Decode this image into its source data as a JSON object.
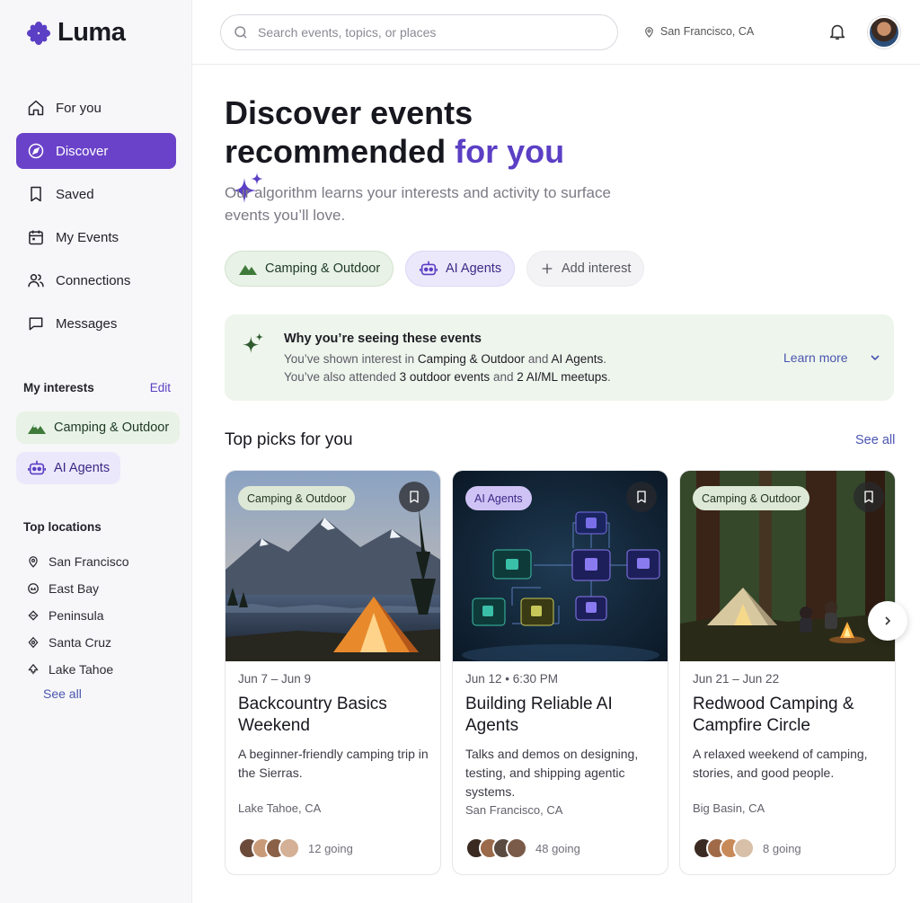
{
  "brand": {
    "name": "Luma",
    "accent": "#6a42c9"
  },
  "sidebar": {
    "nav": [
      {
        "label": "For you",
        "icon": "home-icon"
      },
      {
        "label": "Discover",
        "icon": "compass-icon",
        "active": true
      },
      {
        "label": "Saved",
        "icon": "bookmark-icon"
      },
      {
        "label": "My Events",
        "icon": "calendar-icon"
      },
      {
        "label": "Connections",
        "icon": "people-icon"
      },
      {
        "label": "Messages",
        "icon": "message-icon"
      }
    ],
    "interests_title": "My interests",
    "interests_edit": "Edit",
    "interests": [
      {
        "label": "Camping & Outdoor",
        "icon": "mountain-icon"
      },
      {
        "label": "AI Agents",
        "icon": "robot-icon"
      }
    ],
    "locations_title": "Top locations",
    "locations": [
      "San Francisco",
      "East Bay",
      "Peninsula",
      "Santa Cruz",
      "Lake Tahoe"
    ],
    "locations_see_all": "See all"
  },
  "topbar": {
    "search_placeholder": "Search events, topics, or places",
    "location": "San Francisco, CA"
  },
  "hero": {
    "title_line1": "Discover events",
    "title_line2_plain": "recommended",
    "title_line2_accent": "for you",
    "subtitle": "Our algorithm learns your interests and activity to surface events you’ll love."
  },
  "interest_chips": [
    {
      "label": "Camping & Outdoor"
    },
    {
      "label": "AI Agents"
    },
    {
      "label": "Add interest"
    }
  ],
  "why": {
    "title": "Why you’re seeing these events",
    "line1_pre": "You’ve shown interest in ",
    "line1_a": "Camping & Outdoor",
    "line1_mid": " and ",
    "line1_b": "AI Agents",
    "line1_post": ".",
    "line2_pre": "You’ve also attended ",
    "line2_a": "3 outdoor events",
    "line2_mid": " and ",
    "line2_b": "2 AI/ML meetups",
    "line2_post": ".",
    "learn_more": "Learn more"
  },
  "picks": {
    "title": "Top picks for you",
    "see_all": "See all",
    "cards": [
      {
        "tag": "Camping & Outdoor",
        "date": "Jun 7 – Jun 9",
        "title": "Backcountry Basics Weekend",
        "desc": "A beginner-friendly camping trip in the Sierras.",
        "location": "Lake Tahoe, CA",
        "going": "12 going"
      },
      {
        "tag": "AI Agents",
        "date": "Jun 12 • 6:30 PM",
        "title": "Building Reliable AI Agents",
        "desc": "Talks and demos on designing, testing, and shipping agentic systems.",
        "location": "San Francisco, CA",
        "going": "48 going"
      },
      {
        "tag": "Camping & Outdoor",
        "date": "Jun 21 – Jun 22",
        "title": "Redwood Camping & Campfire Circle",
        "desc": "A relaxed weekend of camping, stories, and good people.",
        "location": "Big Basin, CA",
        "going": "8 going"
      }
    ]
  }
}
